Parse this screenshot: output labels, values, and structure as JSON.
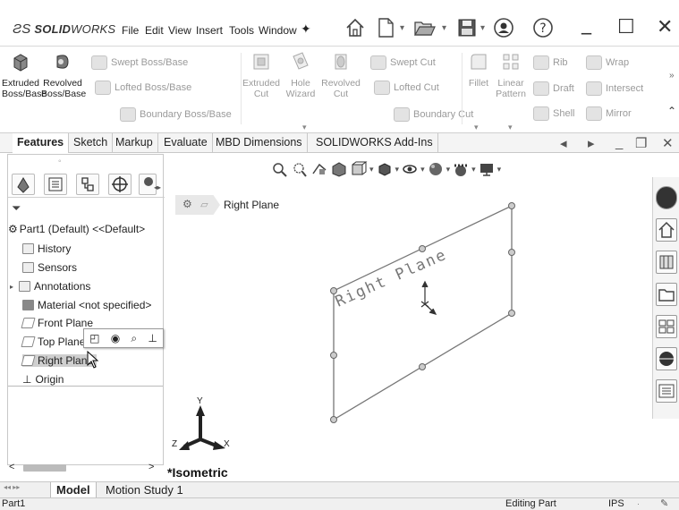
{
  "app": {
    "logo_prefix": "ƧS",
    "logo_bold": "SOLID",
    "logo_light": "WORKS"
  },
  "menu": [
    "File",
    "Edit",
    "View",
    "Insert",
    "Tools",
    "Window"
  ],
  "ribbon": {
    "extruded_boss": [
      "Extruded",
      "Boss/Base"
    ],
    "revolved_boss": [
      "Revolved",
      "Boss/Base"
    ],
    "swept_boss": "Swept Boss/Base",
    "lofted_boss": "Lofted Boss/Base",
    "boundary_boss": "Boundary Boss/Base",
    "extruded_cut": [
      "Extruded",
      "Cut"
    ],
    "hole_wizard": [
      "Hole",
      "Wizard"
    ],
    "revolved_cut": [
      "Revolved",
      "Cut"
    ],
    "swept_cut": "Swept Cut",
    "lofted_cut": "Lofted Cut",
    "boundary_cut": "Boundary Cut",
    "fillet": "Fillet",
    "linear_pattern": [
      "Linear",
      "Pattern"
    ],
    "rib": "Rib",
    "draft": "Draft",
    "shell": "Shell",
    "wrap": "Wrap",
    "intersect": "Intersect",
    "mirror": "Mirror"
  },
  "tabs": [
    "Features",
    "Sketch",
    "Markup",
    "Evaluate",
    "MBD Dimensions",
    "SOLIDWORKS Add-Ins"
  ],
  "tree": {
    "root": "Part1 (Default) <<Default>",
    "items": [
      {
        "label": "History",
        "icon": "history-icon"
      },
      {
        "label": "Sensors",
        "icon": "sensors-icon"
      },
      {
        "label": "Annotations",
        "icon": "annotations-icon"
      },
      {
        "label": "Material <not specified>",
        "icon": "material-icon"
      },
      {
        "label": "Front Plane",
        "icon": "plane-icon"
      },
      {
        "label": "Top Plane",
        "icon": "plane-icon"
      },
      {
        "label": "Right Plane",
        "icon": "plane-icon"
      },
      {
        "label": "Origin",
        "icon": "origin-icon"
      }
    ]
  },
  "breadcrumb": "Right Plane",
  "plane_label": "Right Plane",
  "view_label": "*Isometric",
  "triad": {
    "y": "Y",
    "z": "Z",
    "x": "X"
  },
  "bottom_tabs": [
    "Model",
    "Motion Study 1"
  ],
  "status": {
    "left": "Part1",
    "mode": "Editing Part",
    "units": "IPS"
  }
}
